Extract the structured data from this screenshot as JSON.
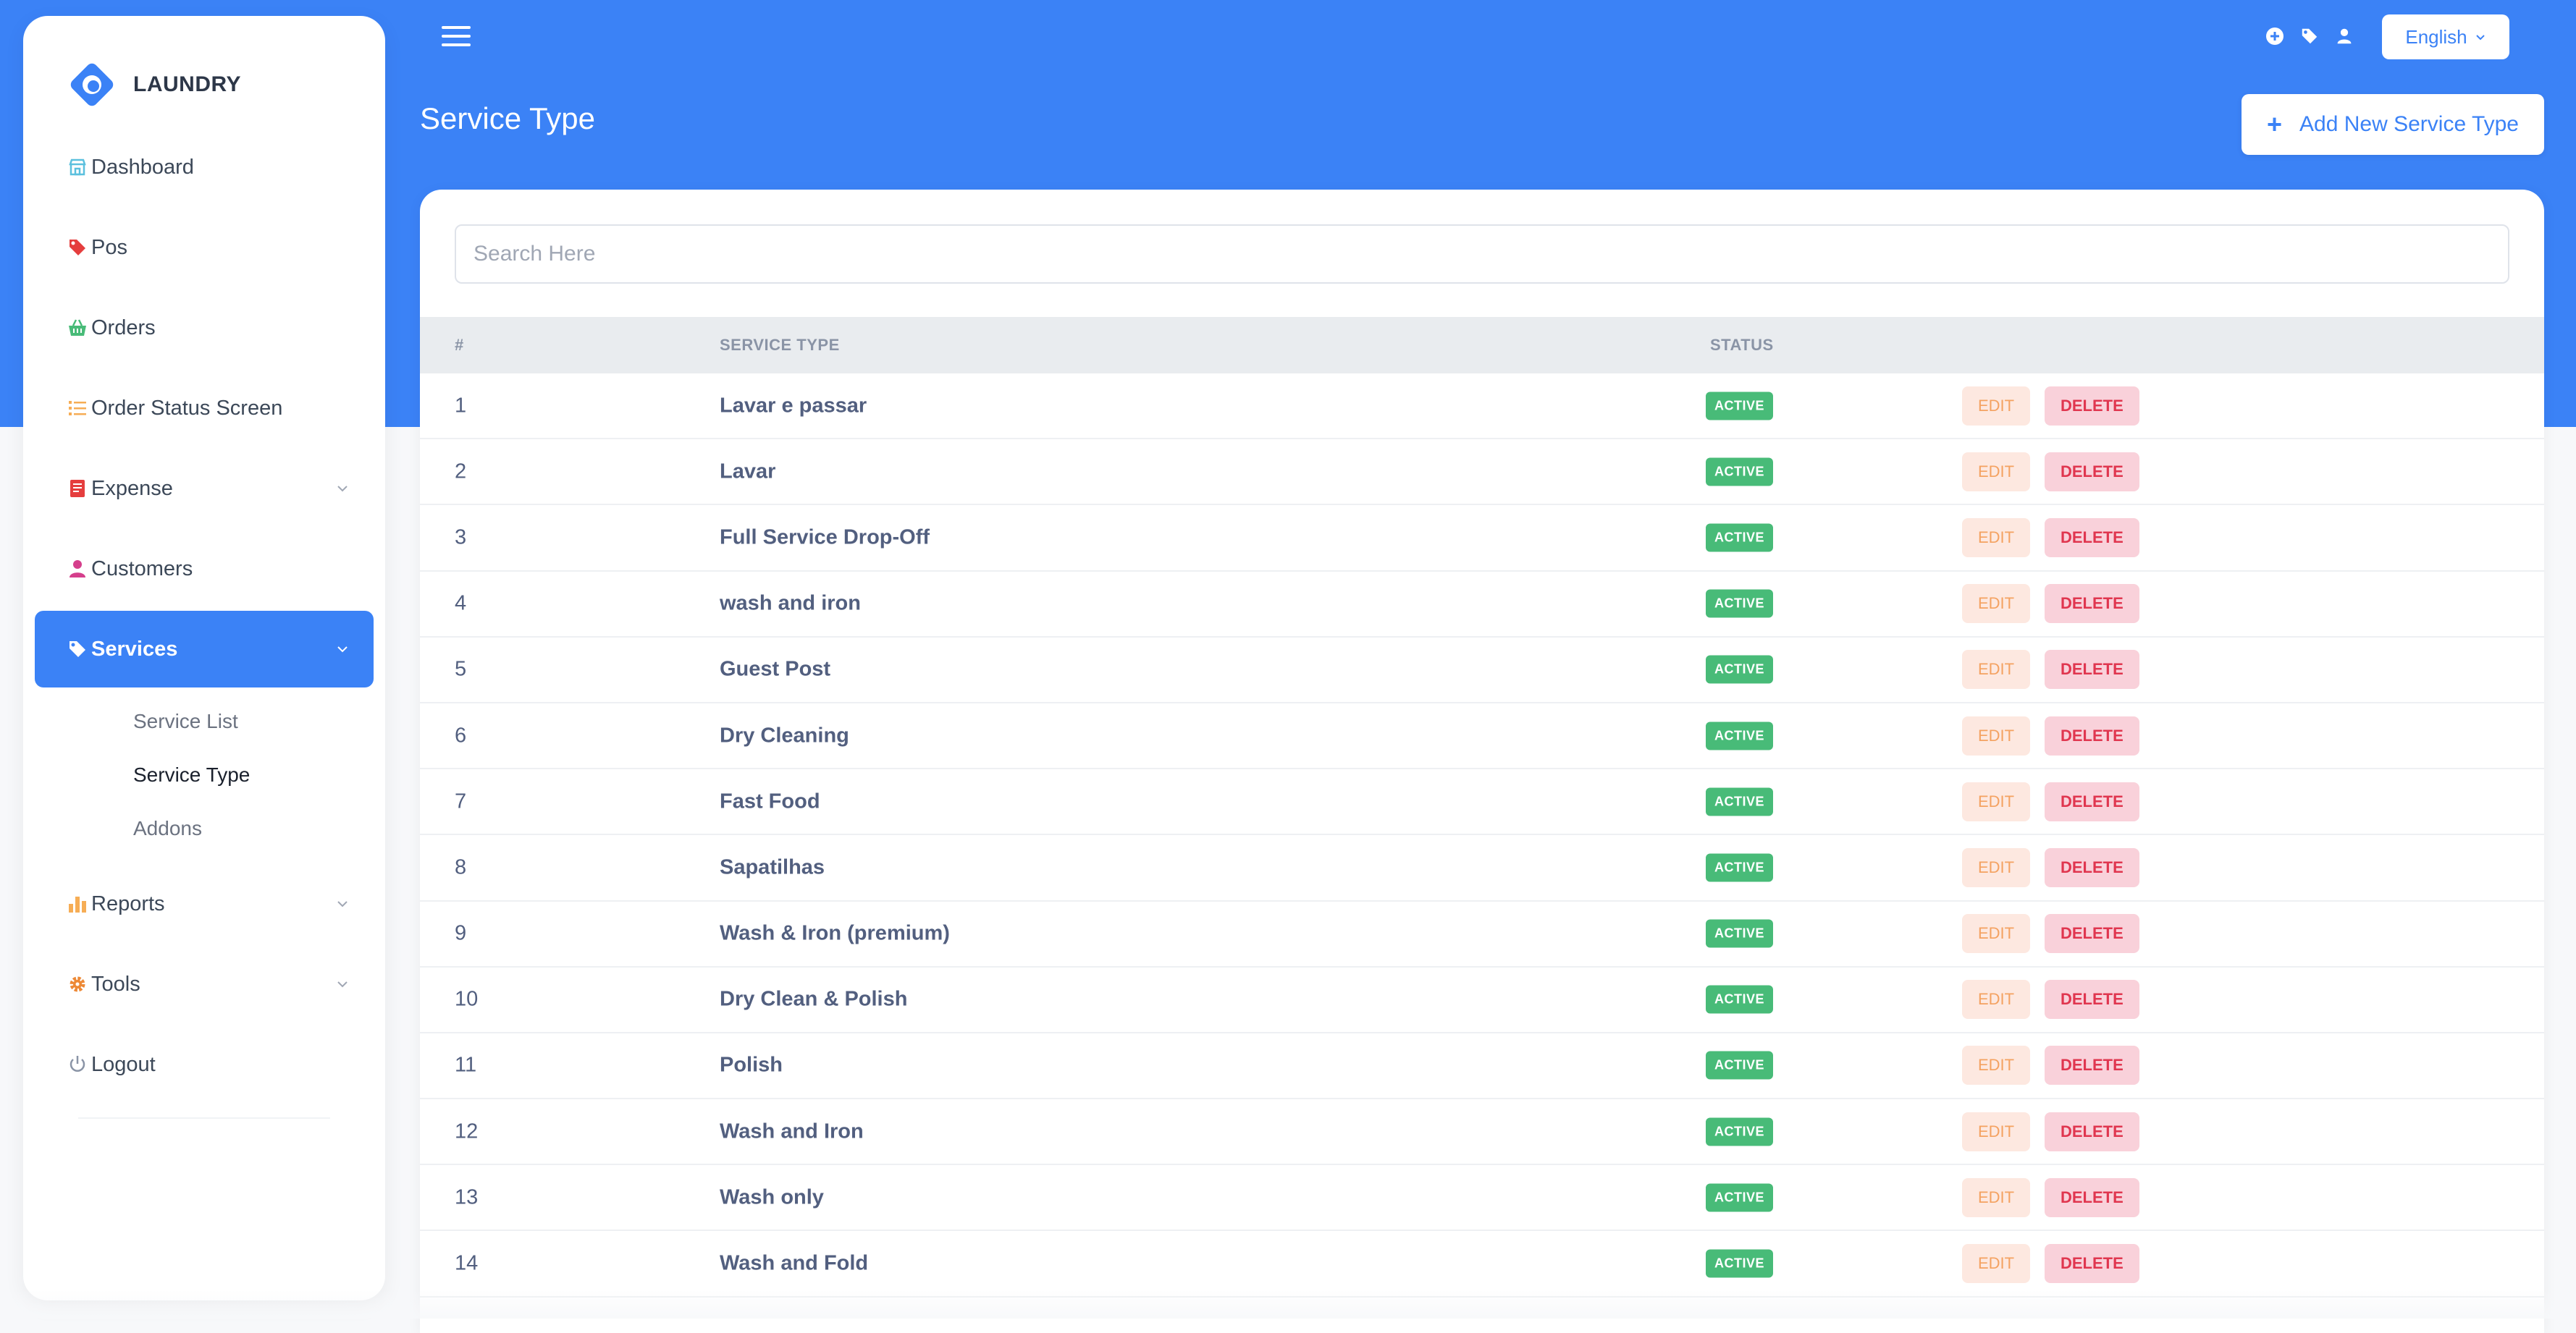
{
  "brand": {
    "name": "LAUNDRY"
  },
  "sidebar": {
    "items": [
      {
        "label": "Dashboard",
        "icon": "store-icon"
      },
      {
        "label": "Pos",
        "icon": "tag-icon"
      },
      {
        "label": "Orders",
        "icon": "basket-icon"
      },
      {
        "label": "Order Status Screen",
        "icon": "list-icon"
      },
      {
        "label": "Expense",
        "icon": "receipt-icon"
      },
      {
        "label": "Customers",
        "icon": "user-icon"
      },
      {
        "label": "Services",
        "icon": "tags-icon"
      },
      {
        "label": "Reports",
        "icon": "bar-chart-icon"
      },
      {
        "label": "Tools",
        "icon": "gear-icon"
      },
      {
        "label": "Logout",
        "icon": "power-icon"
      }
    ],
    "services_sub": [
      "Service List",
      "Service Type",
      "Addons"
    ]
  },
  "topbar": {
    "language": "English"
  },
  "page": {
    "title": "Service Type",
    "add_button": "Add New Service Type"
  },
  "search": {
    "placeholder": "Search Here"
  },
  "table": {
    "headers": [
      "#",
      "SERVICE TYPE",
      "STATUS"
    ],
    "status_label": "ACTIVE",
    "edit_label": "EDIT",
    "delete_label": "DELETE",
    "rows": [
      {
        "num": "1",
        "name": "Lavar e passar"
      },
      {
        "num": "2",
        "name": "Lavar"
      },
      {
        "num": "3",
        "name": "Full Service Drop-Off"
      },
      {
        "num": "4",
        "name": "wash and iron"
      },
      {
        "num": "5",
        "name": "Guest Post"
      },
      {
        "num": "6",
        "name": "Dry Cleaning"
      },
      {
        "num": "7",
        "name": "Fast Food"
      },
      {
        "num": "8",
        "name": "Sapatilhas"
      },
      {
        "num": "9",
        "name": "Wash & Iron (premium)"
      },
      {
        "num": "10",
        "name": "Dry Clean & Polish"
      },
      {
        "num": "11",
        "name": "Polish"
      },
      {
        "num": "12",
        "name": "Wash and Iron"
      },
      {
        "num": "13",
        "name": "Wash only"
      },
      {
        "num": "14",
        "name": "Wash and Fold"
      }
    ]
  },
  "colors": {
    "primary": "#3b82f6",
    "active_badge": "#48bb78",
    "edit_text": "#f4a261",
    "delete_text": "#e0364f"
  }
}
